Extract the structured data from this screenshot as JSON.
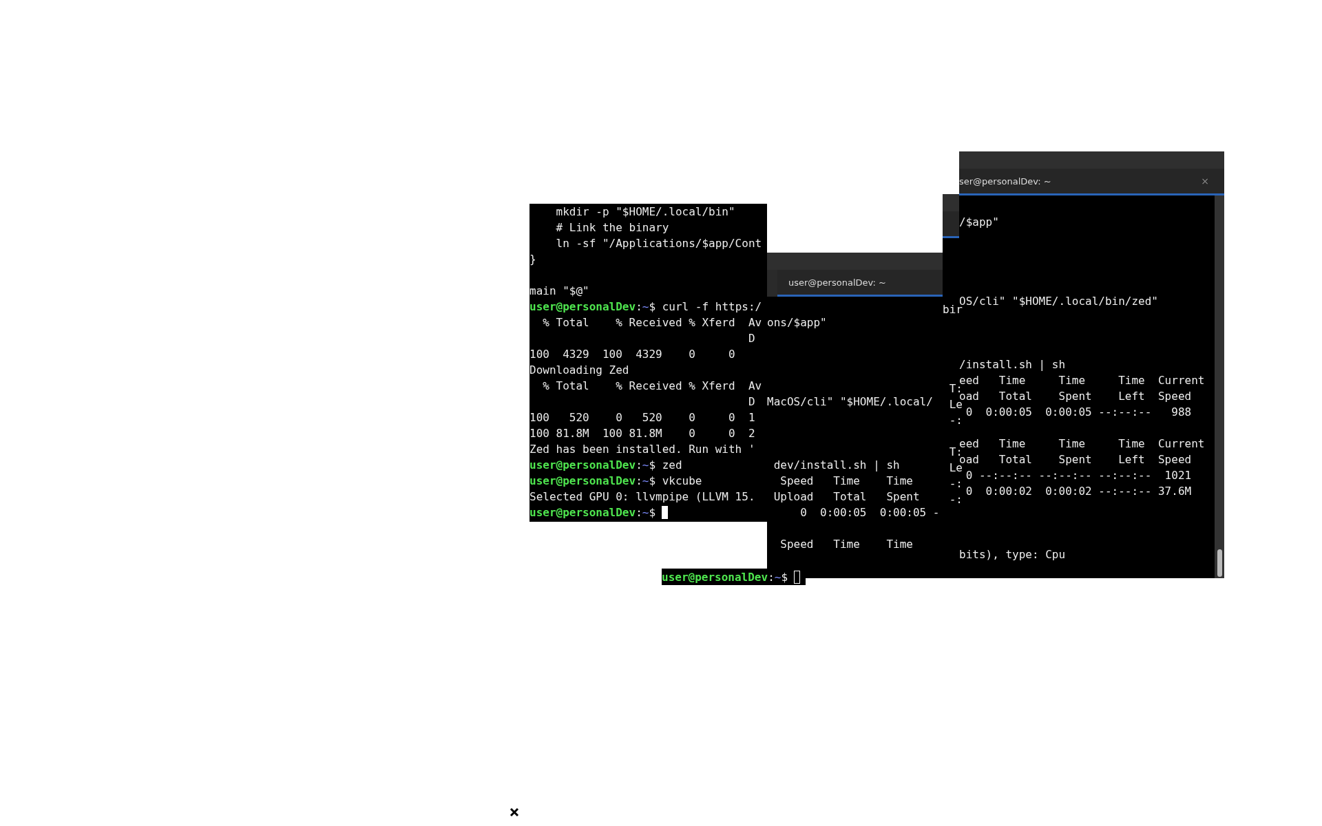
{
  "windows": [
    {
      "kind": "plain",
      "lines": [
        {
          "kind": "text",
          "text": "    mkdir -p \"$HOME/.local/bin\""
        },
        {
          "kind": "text",
          "text": "    # Link the binary"
        },
        {
          "kind": "text",
          "text": "    ln -sf \"/Applications/$app/Cont"
        },
        {
          "kind": "text",
          "text": "}"
        },
        {
          "kind": "blank"
        },
        {
          "kind": "text",
          "text": "main \"$@\""
        },
        {
          "kind": "prompt",
          "user": "user@personalDev",
          "sep": ":",
          "dir": "~",
          "sign": "$",
          "command": " curl -f https:/"
        },
        {
          "kind": "text",
          "text": "  % Total    % Received % Xferd  Av"
        },
        {
          "kind": "text",
          "text": "                                 D"
        },
        {
          "kind": "text",
          "text": "100  4329  100  4329    0     0"
        },
        {
          "kind": "text",
          "text": "Downloading Zed"
        },
        {
          "kind": "text",
          "text": "  % Total    % Received % Xferd  Av"
        },
        {
          "kind": "text",
          "text": "                                 D"
        },
        {
          "kind": "text",
          "text": "100   520    0   520    0     0  1"
        },
        {
          "kind": "text",
          "text": "100 81.8M  100 81.8M    0     0  2"
        },
        {
          "kind": "text",
          "text": "Zed has been installed. Run with '"
        },
        {
          "kind": "prompt",
          "user": "user@personalDev",
          "sep": ":",
          "dir": "~",
          "sign": "$",
          "command": " zed"
        },
        {
          "kind": "prompt",
          "user": "user@personalDev",
          "sep": ":",
          "dir": "~",
          "sign": "$",
          "command": " vkcube"
        },
        {
          "kind": "text",
          "text": "Selected GPU 0: llvmpipe (LLVM 15."
        },
        {
          "kind": "prompt",
          "user": "user@personalDev",
          "sep": ":",
          "dir": "~",
          "sign": "$",
          "cursor_focused": true
        }
      ]
    },
    {
      "kind": "tabbed",
      "title": "user@personalDev: ~",
      "lines": [
        {
          "kind": "text",
          "text": "ons/$app\""
        },
        {
          "kind": "blank"
        },
        {
          "kind": "blank"
        },
        {
          "kind": "blank"
        },
        {
          "kind": "blank"
        },
        {
          "kind": "text",
          "text": "MacOS/cli\" \"$HOME/.local/"
        },
        {
          "kind": "blank"
        },
        {
          "kind": "blank"
        },
        {
          "kind": "blank"
        },
        {
          "kind": "text",
          "text": " dev/install.sh | sh"
        },
        {
          "kind": "text",
          "text": "  Speed   Time    Time"
        },
        {
          "kind": "text",
          "text": " Upload   Total   Spent"
        },
        {
          "kind": "text",
          "text": "     0  0:00:05  0:00:05 -"
        },
        {
          "kind": "blank"
        },
        {
          "kind": "text",
          "text": "  Speed   Time    Time"
        }
      ]
    },
    {
      "kind": "sliver",
      "lines": [
        {
          "kind": "text",
          "text": "bir"
        },
        {
          "kind": "blank"
        },
        {
          "kind": "blank"
        },
        {
          "kind": "blank"
        },
        {
          "kind": "blank"
        },
        {
          "kind": "text",
          "text": " T:"
        },
        {
          "kind": "text",
          "text": " Le"
        },
        {
          "kind": "text",
          "text": " -:"
        },
        {
          "kind": "blank"
        },
        {
          "kind": "text",
          "text": " T:"
        },
        {
          "kind": "text",
          "text": " Le"
        },
        {
          "kind": "text",
          "text": " -:"
        },
        {
          "kind": "text",
          "text": " -:"
        }
      ]
    },
    {
      "kind": "scrolled",
      "title": "ser@personalDev: ~",
      "close_label": "×",
      "lines": [
        {
          "kind": "text",
          "text": "/$app\""
        },
        {
          "kind": "blank"
        },
        {
          "kind": "blank"
        },
        {
          "kind": "blank"
        },
        {
          "kind": "blank"
        },
        {
          "kind": "text",
          "text": "OS/cli\" \"$HOME/.local/bin/zed\""
        },
        {
          "kind": "blank"
        },
        {
          "kind": "blank"
        },
        {
          "kind": "blank"
        },
        {
          "kind": "text",
          "text": "/install.sh | sh"
        },
        {
          "kind": "text",
          "text": "eed   Time     Time     Time  Current"
        },
        {
          "kind": "text",
          "text": "oad   Total    Spent    Left  Speed"
        },
        {
          "kind": "text",
          "text": " 0  0:00:05  0:00:05 --:--:--   988"
        },
        {
          "kind": "blank"
        },
        {
          "kind": "text",
          "text": "eed   Time     Time     Time  Current"
        },
        {
          "kind": "text",
          "text": "oad   Total    Spent    Left  Speed"
        },
        {
          "kind": "text",
          "text": " 0 --:--:-- --:--:-- --:--:--  1021"
        },
        {
          "kind": "text",
          "text": " 0  0:00:02  0:00:02 --:--:-- 37.6M"
        },
        {
          "kind": "blank"
        },
        {
          "kind": "blank"
        },
        {
          "kind": "blank"
        },
        {
          "kind": "text",
          "text": "bits), type: Cpu"
        }
      ]
    }
  ],
  "prompt_strip": {
    "user": "user@personalDev",
    "sep": ":",
    "dir": "~",
    "sign": "$",
    "cursor_focused": false
  }
}
